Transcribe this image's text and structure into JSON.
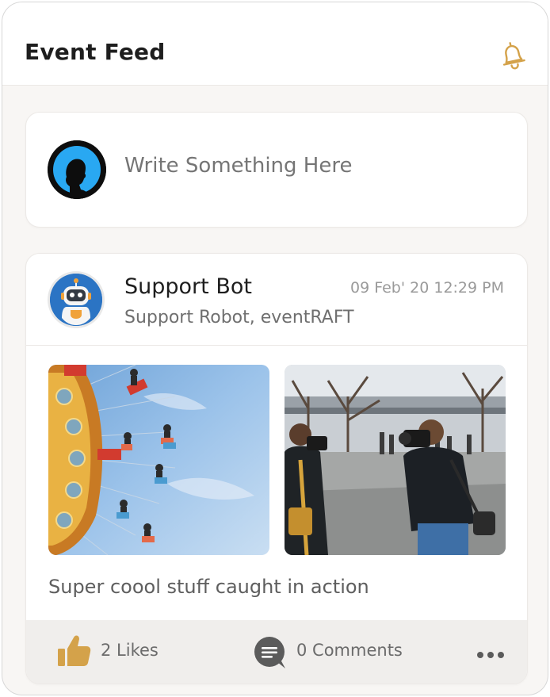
{
  "header": {
    "title": "Event Feed",
    "icon": "bell-icon"
  },
  "composer": {
    "placeholder": "Write Something Here",
    "avatar_icon": "user-avatar"
  },
  "post": {
    "author": "Support Bot",
    "subtitle": "Support Robot, eventRAFT",
    "timestamp": "09 Feb' 20 12:29 PM",
    "caption": "Super coool stuff caught in action",
    "likes": "2 Likes",
    "comments": "0 Comments",
    "photos": [
      "carnival-swing-ride-photo",
      "photographers-in-rain-photo"
    ]
  },
  "colors": {
    "accent_gold": "#d4a24a",
    "bot_blue": "#2b74c4",
    "composer_ring": "#29a8f2"
  }
}
